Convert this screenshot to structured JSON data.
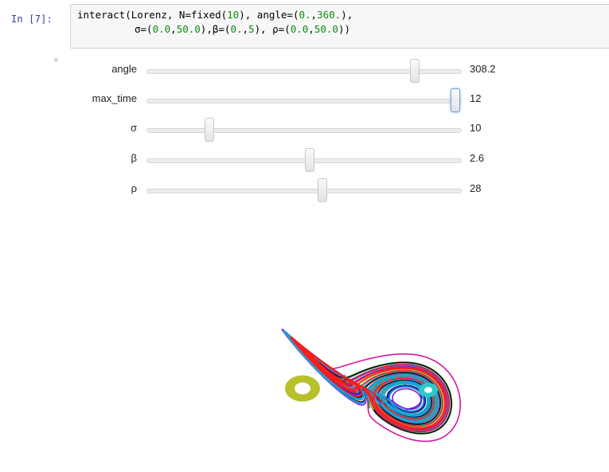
{
  "cell": {
    "prompt": "In [7]:",
    "code_line1_parts": [
      "interact(Lorenz, N=fixed(",
      "10",
      "), angle=(",
      "0.",
      ",",
      "360.",
      "),"
    ],
    "code_line2_parts": [
      "σ=(",
      "0.0",
      ",",
      "50.0",
      "),β=(",
      "0.",
      ",",
      "5",
      "), ρ=(",
      "0.0",
      ",",
      "50.0",
      "))"
    ]
  },
  "widget_close_label": "×",
  "sliders": [
    {
      "label": "angle",
      "value": "308.2",
      "fraction": 0.856,
      "focused": false
    },
    {
      "label": "max_time",
      "value": "12",
      "fraction": 0.985,
      "focused": true
    },
    {
      "label": "σ",
      "value": "10",
      "fraction": 0.2,
      "focused": false
    },
    {
      "label": "β",
      "value": "2.6",
      "fraction": 0.52,
      "focused": false
    },
    {
      "label": "ρ",
      "value": "28",
      "fraction": 0.56,
      "focused": false
    }
  ],
  "plot": {
    "type": "lorenz-attractor-3d-projection",
    "trajectory_colors": [
      "#1f9e3a",
      "#d4189e",
      "#e0202a",
      "#2bc9c9",
      "#7a1fd6",
      "#b8c02a",
      "#111111",
      "#3a1ee0",
      "#14a8d8",
      "#ff1a1a"
    ]
  }
}
